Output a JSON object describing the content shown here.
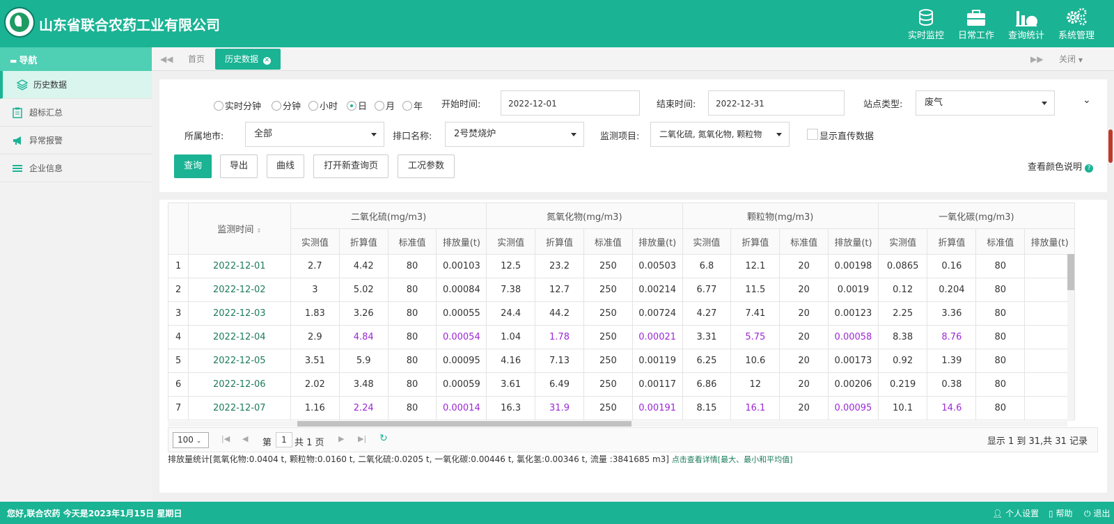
{
  "header": {
    "company": "山东省联合农药工业有限公司",
    "nav": [
      {
        "label": "实时监控",
        "icon": "database-icon"
      },
      {
        "label": "日常工作",
        "icon": "briefcase-icon"
      },
      {
        "label": "查询统计",
        "icon": "bar-chart-icon"
      },
      {
        "label": "系统管理",
        "icon": "gears-icon"
      }
    ]
  },
  "sidebar": {
    "title": "导航",
    "items": [
      {
        "label": "历史数据",
        "icon": "layers-icon"
      },
      {
        "label": "超标汇总",
        "icon": "clipboard-icon"
      },
      {
        "label": "异常报警",
        "icon": "megaphone-icon"
      },
      {
        "label": "企业信息",
        "icon": "list-icon"
      }
    ]
  },
  "tabs": {
    "home": "首页",
    "active": "历史数据",
    "close": "关闭"
  },
  "filters": {
    "radios": [
      "实时分钟",
      "分钟",
      "小时",
      "日",
      "月",
      "年"
    ],
    "selected_radio": "日",
    "start_label": "开始时间:",
    "start_value": "2022-12-01",
    "end_label": "结束时间:",
    "end_value": "2022-12-31",
    "site_type_label": "站点类型:",
    "site_type_value": "废气",
    "city_label": "所属地市:",
    "city_value": "全部",
    "outlet_label": "排口名称:",
    "outlet_value": "2号焚烧炉",
    "item_label": "监测项目:",
    "item_value": "二氧化硫, 氮氧化物, 颗粒物",
    "direct_label": "显示直传数据",
    "color_help": "查看颜色说明"
  },
  "buttons": {
    "query": "查询",
    "export": "导出",
    "curve": "曲线",
    "open_new": "打开新查询页",
    "params": "工况参数"
  },
  "table": {
    "time_header": "监测时间",
    "groups": [
      "二氧化硫(mg/m3)",
      "氮氧化物(mg/m3)",
      "颗粒物(mg/m3)",
      "一氧化碳(mg/m3)"
    ],
    "sub_headers": [
      "实测值",
      "折算值",
      "标准值",
      "排放量(t)"
    ],
    "rows": [
      {
        "idx": "1",
        "date": "2022-12-01",
        "vals": [
          "2.7",
          "4.42",
          "80",
          "0.00103",
          "12.5",
          "23.2",
          "250",
          "0.00503",
          "6.8",
          "12.1",
          "20",
          "0.00198",
          "0.0865",
          "0.16",
          "80"
        ],
        "purple": false
      },
      {
        "idx": "2",
        "date": "2022-12-02",
        "vals": [
          "3",
          "5.02",
          "80",
          "0.00084",
          "7.38",
          "12.7",
          "250",
          "0.00214",
          "6.77",
          "11.5",
          "20",
          "0.0019",
          "0.12",
          "0.204",
          "80"
        ],
        "purple": false
      },
      {
        "idx": "3",
        "date": "2022-12-03",
        "vals": [
          "1.83",
          "3.26",
          "80",
          "0.00055",
          "24.4",
          "44.2",
          "250",
          "0.00724",
          "4.27",
          "7.41",
          "20",
          "0.00123",
          "2.25",
          "3.36",
          "80"
        ],
        "purple": false
      },
      {
        "idx": "4",
        "date": "2022-12-04",
        "vals": [
          "2.9",
          "4.84",
          "80",
          "0.00054",
          "1.04",
          "1.78",
          "250",
          "0.00021",
          "3.31",
          "5.75",
          "20",
          "0.00058",
          "8.38",
          "8.76",
          "80"
        ],
        "purple": true
      },
      {
        "idx": "5",
        "date": "2022-12-05",
        "vals": [
          "3.51",
          "5.9",
          "80",
          "0.00095",
          "4.16",
          "7.13",
          "250",
          "0.00119",
          "6.25",
          "10.6",
          "20",
          "0.00173",
          "0.92",
          "1.39",
          "80"
        ],
        "purple": false
      },
      {
        "idx": "6",
        "date": "2022-12-06",
        "vals": [
          "2.02",
          "3.48",
          "80",
          "0.00059",
          "3.61",
          "6.49",
          "250",
          "0.00117",
          "6.86",
          "12",
          "20",
          "0.00206",
          "0.219",
          "0.38",
          "80"
        ],
        "purple": false
      },
      {
        "idx": "7",
        "date": "2022-12-07",
        "vals": [
          "1.16",
          "2.24",
          "80",
          "0.00014",
          "16.3",
          "31.9",
          "250",
          "0.00191",
          "8.15",
          "16.1",
          "20",
          "0.00095",
          "10.1",
          "14.6",
          "80"
        ],
        "purple": true
      }
    ]
  },
  "pager": {
    "page_size": "100",
    "page_prefix": "第",
    "page_value": "1",
    "page_suffix": "共 1 页",
    "summary": "显示 1 到 31,共 31 记录"
  },
  "stats": {
    "text": "排放量统计[氮氧化物:0.0404 t, 颗粒物:0.0160 t, 二氧化硫:0.0205 t, 一氧化碳:0.00446 t, 氯化氢:0.00346 t, 流量 :3841685 m3]",
    "link": "点击查看详情[最大、最小和平均值]"
  },
  "footer": {
    "greeting": "您好,联合农药 今天是2023年1月15日 星期日",
    "personal": "个人设置",
    "help": "帮助",
    "logout": "退出"
  },
  "colors": {
    "primary": "#1ab394",
    "purple": "#9c27d6",
    "date_green": "#1b7b5c"
  }
}
